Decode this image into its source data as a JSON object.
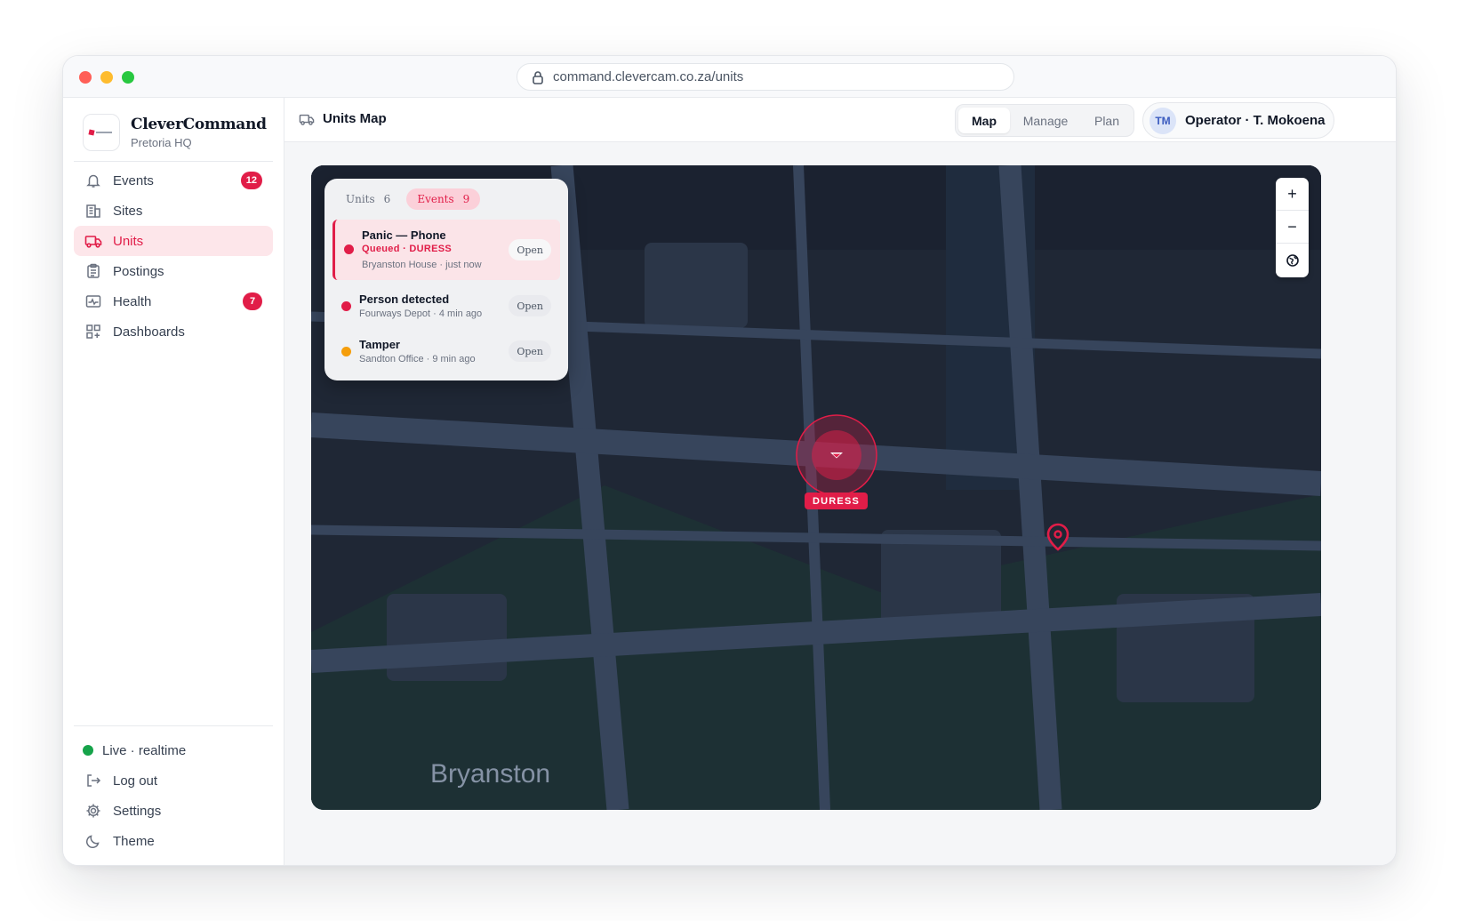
{
  "window": {
    "url": "command.clevercam.co.za/units"
  },
  "brand": {
    "name": "CleverCommand",
    "sub": "Pretoria HQ"
  },
  "nav": [
    {
      "label": "Events",
      "icon": "bell-icon",
      "badge": "12"
    },
    {
      "label": "Sites",
      "icon": "building-icon"
    },
    {
      "label": "Units",
      "icon": "truck-icon",
      "active": true
    },
    {
      "label": "Postings",
      "icon": "clipboard-icon"
    },
    {
      "label": "Health",
      "icon": "pulse-icon",
      "badge": "7"
    },
    {
      "label": "Dashboards",
      "icon": "grid-icon"
    }
  ],
  "bottom_nav": {
    "live": "Live · realtime",
    "logout": "Log out",
    "settings": "Settings",
    "theme": "Theme"
  },
  "topbar": {
    "title": "Units Map",
    "tabs": [
      "Map",
      "Manage",
      "Plan"
    ],
    "active_tab": "Map",
    "user_initials": "TM",
    "user_name": "Operator · T. Mokoena"
  },
  "panel": {
    "tabs": [
      {
        "label": "Units",
        "count": "6"
      },
      {
        "label": "Events",
        "count": "9",
        "active": true
      }
    ],
    "events": [
      {
        "title": "Panic — Phone",
        "status": "Queued · DURESS",
        "meta": "Bryanston House · just now",
        "action": "Open",
        "color": "#e11d48",
        "selected": true
      },
      {
        "title": "Person detected",
        "meta": "Fourways Depot · 4 min ago",
        "action": "Open",
        "color": "#e11d48"
      },
      {
        "title": "Tamper",
        "meta": "Sandton Office · 9 min ago",
        "action": "Open",
        "color": "#f59e0b"
      }
    ]
  },
  "map": {
    "place_label": "Bryanston",
    "duress_label": "DURESS",
    "zoom_in": "+",
    "zoom_out": "−"
  },
  "colors": {
    "accent": "#e11d48",
    "live": "#16a34a",
    "warning": "#f59e0b"
  }
}
